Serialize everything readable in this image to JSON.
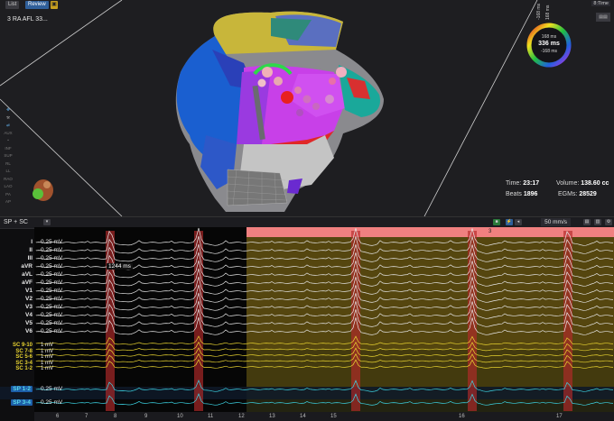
{
  "tabs": [
    {
      "label": "List",
      "active": false
    },
    {
      "label": "Review",
      "active": true
    }
  ],
  "map_title": "3 RA AFL 33...",
  "color_scale": {
    "top_left": "-168 ms",
    "top_right": "168 ms",
    "center_top": "168 ms",
    "center_value": "336 ms",
    "center_bottom": "-168 ms"
  },
  "right_tool_label": "8:Time",
  "stats": {
    "time_label": "Time:",
    "time_value": "23:17",
    "beats_label": "Beats",
    "beats_value": "1896",
    "volume_label": "Volume:",
    "volume_value": "138.60 cc",
    "egms_label": "EGMs:",
    "egms_value": "28529"
  },
  "tool_labels": [
    "AUX",
    "INF",
    "SUP",
    "RL",
    "LL",
    "RAO",
    "LAO",
    "PA",
    "AP"
  ],
  "ecg": {
    "pane_label": "SP + SC",
    "speed": "50 mm/s",
    "segment_marker": "3",
    "cycle_length": "1244 ms",
    "leads": [
      {
        "name": "I",
        "gain": "0.25 mV"
      },
      {
        "name": "II",
        "gain": "0.25 mV"
      },
      {
        "name": "III",
        "gain": "0.25 mV"
      },
      {
        "name": "aVR",
        "gain": "0.25 mV"
      },
      {
        "name": "aVL",
        "gain": "0.25 mV"
      },
      {
        "name": "aVF",
        "gain": "0.25 mV"
      },
      {
        "name": "V1",
        "gain": "0.25 mV"
      },
      {
        "name": "V2",
        "gain": "0.25 mV"
      },
      {
        "name": "V3",
        "gain": "0.25 mV"
      },
      {
        "name": "V4",
        "gain": "0.25 mV"
      },
      {
        "name": "V5",
        "gain": "0.25 mV"
      },
      {
        "name": "V6",
        "gain": "0.25 mV"
      }
    ],
    "sc_leads": [
      {
        "name": "SC 9-10",
        "gain": "1 mV"
      },
      {
        "name": "SC 7-8",
        "gain": "1 mV"
      },
      {
        "name": "SC 5-6",
        "gain": "1 mV"
      },
      {
        "name": "SC 3-4",
        "gain": "1 mV"
      },
      {
        "name": "SC 1-2",
        "gain": "1 mV"
      }
    ],
    "sp_leads": [
      {
        "name": "SP 1-2",
        "gain": "0.25 mV"
      },
      {
        "name": "SP 3-4",
        "gain": "0.25 mV"
      }
    ],
    "beat_numbers": [
      "6",
      "7",
      "8",
      "9",
      "10",
      "11",
      "12",
      "13",
      "14",
      "15",
      "16",
      "17"
    ]
  }
}
